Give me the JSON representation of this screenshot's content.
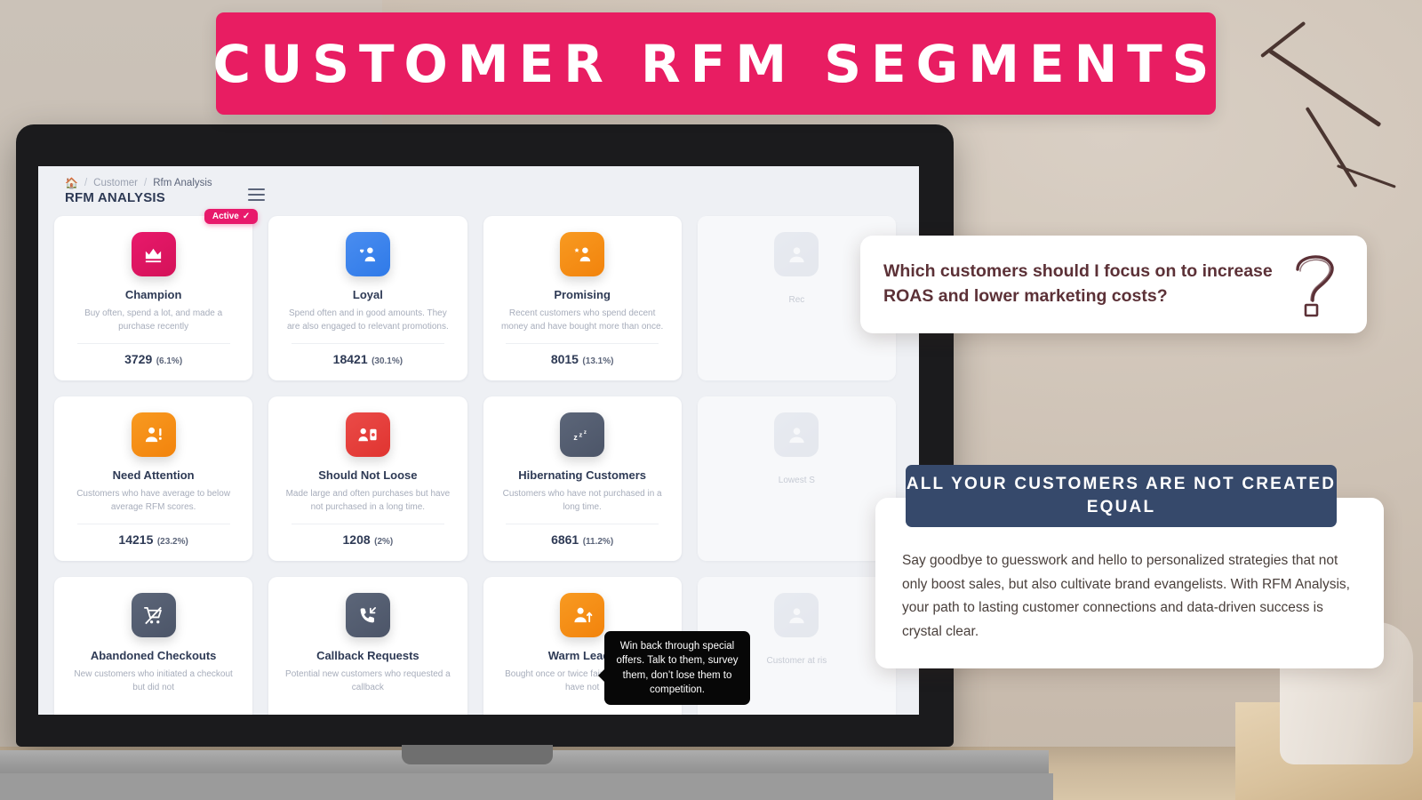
{
  "banner": {
    "title": "CUSTOMER RFM SEGMENTS"
  },
  "app": {
    "breadcrumb": {
      "home_icon": "home-icon",
      "items": [
        "Customer",
        "Rfm Analysis"
      ],
      "separator": "/"
    },
    "page_title": "RFM ANALYSIS",
    "menu_icon": "hamburger-icon",
    "badge": {
      "label": "Active",
      "check": "✓"
    },
    "cards": [
      {
        "title": "Champion",
        "desc": "Buy often, spend a lot, and made a purchase recently",
        "count": "3729",
        "pct": "(6.1%)",
        "color": "#e8196b",
        "color2": "#d41259",
        "icon": "crown-icon"
      },
      {
        "title": "Loyal",
        "desc": "Spend often and in good amounts. They are also engaged to relevant promotions.",
        "count": "18421",
        "pct": "(30.1%)",
        "color": "#4a8df0",
        "color2": "#2f7ae8",
        "icon": "user-heart-icon"
      },
      {
        "title": "Promising",
        "desc": "Recent customers who spend decent money and have bought more than once.",
        "count": "8015",
        "pct": "(13.1%)",
        "color": "#f89a21",
        "color2": "#f2830c",
        "icon": "user-star-icon"
      },
      {
        "title": "",
        "desc": "Rec",
        "count": "",
        "pct": "",
        "color": "#e3e7ee",
        "color2": "#dde1e9",
        "icon": "user-icon"
      },
      {
        "title": "Need Attention",
        "desc": "Customers who have average to below average RFM scores.",
        "count": "14215",
        "pct": "(23.2%)",
        "color": "#f89a21",
        "color2": "#f2830c",
        "icon": "user-alert-icon"
      },
      {
        "title": "Should Not Loose",
        "desc": "Made large and often purchases but have not purchased in a long time.",
        "count": "1208",
        "pct": "(2%)",
        "color": "#ea4b48",
        "color2": "#e03430",
        "icon": "user-card-icon"
      },
      {
        "title": "Hibernating Customers",
        "desc": "Customers who have not purchased in a long time.",
        "count": "6861",
        "pct": "(11.2%)",
        "color": "#5c6679",
        "color2": "#4c5568",
        "icon": "sleep-icon"
      },
      {
        "title": "",
        "desc": "Lowest S",
        "count": "",
        "pct": "",
        "color": "#e3e7ee",
        "color2": "#dde1e9",
        "icon": "user-icon"
      },
      {
        "title": "Abandoned Checkouts",
        "desc": "New customers who initiated a checkout but did not",
        "count": "",
        "pct": "",
        "color": "#5c6679",
        "color2": "#4c5568",
        "icon": "cart-off-icon"
      },
      {
        "title": "Callback Requests",
        "desc": "Potential new customers who requested a callback",
        "count": "",
        "pct": "",
        "color": "#5c6679",
        "color2": "#4c5568",
        "icon": "phone-incoming-icon"
      },
      {
        "title": "Warm Leads",
        "desc": "Bought once or twice fairly recently buy have not",
        "count": "",
        "pct": "",
        "color": "#f89a21",
        "color2": "#f2830c",
        "icon": "user-up-icon"
      },
      {
        "title": "",
        "desc": "Customer at ris",
        "count": "",
        "pct": "",
        "color": "#e3e7ee",
        "color2": "#dde1e9",
        "icon": "user-icon"
      }
    ],
    "tooltip": "Win back through special offers. Talk to them, survey them, don’t lose them to competition."
  },
  "overlays": {
    "question": "Which customers should I focus on to increase ROAS and lower marketing costs?",
    "question_icon": "question-mark-icon",
    "band": "ALL YOUR CUSTOMERS ARE NOT CREATED EQUAL",
    "body": "Say goodbye to guesswork and hello to personalized strategies that not only boost sales, but also cultivate brand evangelists. With RFM Analysis, your path to lasting customer connections and data-driven success is crystal clear."
  },
  "colors": {
    "brand_pink": "#e8196b",
    "navy": "#36496b",
    "text_dark": "#2e3a55",
    "muted": "#a7adbb"
  }
}
